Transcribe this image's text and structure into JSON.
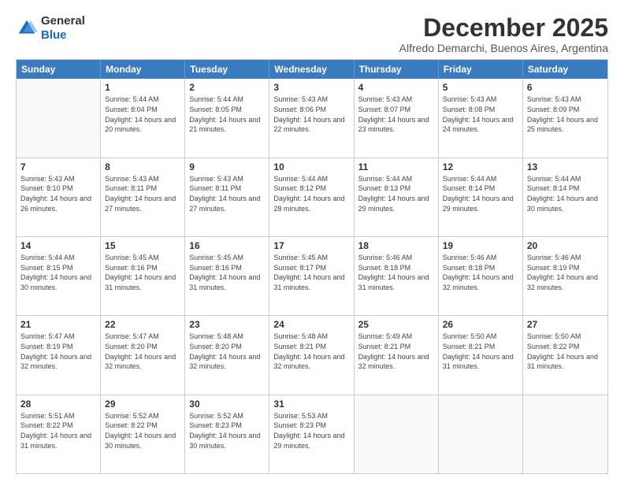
{
  "logo": {
    "general": "General",
    "blue": "Blue"
  },
  "title": "December 2025",
  "subtitle": "Alfredo Demarchi, Buenos Aires, Argentina",
  "days": [
    "Sunday",
    "Monday",
    "Tuesday",
    "Wednesday",
    "Thursday",
    "Friday",
    "Saturday"
  ],
  "weeks": [
    [
      {
        "day": "",
        "sunrise": "",
        "sunset": "",
        "daylight": ""
      },
      {
        "day": "1",
        "sunrise": "Sunrise: 5:44 AM",
        "sunset": "Sunset: 8:04 PM",
        "daylight": "Daylight: 14 hours and 20 minutes."
      },
      {
        "day": "2",
        "sunrise": "Sunrise: 5:44 AM",
        "sunset": "Sunset: 8:05 PM",
        "daylight": "Daylight: 14 hours and 21 minutes."
      },
      {
        "day": "3",
        "sunrise": "Sunrise: 5:43 AM",
        "sunset": "Sunset: 8:06 PM",
        "daylight": "Daylight: 14 hours and 22 minutes."
      },
      {
        "day": "4",
        "sunrise": "Sunrise: 5:43 AM",
        "sunset": "Sunset: 8:07 PM",
        "daylight": "Daylight: 14 hours and 23 minutes."
      },
      {
        "day": "5",
        "sunrise": "Sunrise: 5:43 AM",
        "sunset": "Sunset: 8:08 PM",
        "daylight": "Daylight: 14 hours and 24 minutes."
      },
      {
        "day": "6",
        "sunrise": "Sunrise: 5:43 AM",
        "sunset": "Sunset: 8:09 PM",
        "daylight": "Daylight: 14 hours and 25 minutes."
      }
    ],
    [
      {
        "day": "7",
        "sunrise": "Sunrise: 5:43 AM",
        "sunset": "Sunset: 8:10 PM",
        "daylight": "Daylight: 14 hours and 26 minutes."
      },
      {
        "day": "8",
        "sunrise": "Sunrise: 5:43 AM",
        "sunset": "Sunset: 8:11 PM",
        "daylight": "Daylight: 14 hours and 27 minutes."
      },
      {
        "day": "9",
        "sunrise": "Sunrise: 5:43 AM",
        "sunset": "Sunset: 8:11 PM",
        "daylight": "Daylight: 14 hours and 27 minutes."
      },
      {
        "day": "10",
        "sunrise": "Sunrise: 5:44 AM",
        "sunset": "Sunset: 8:12 PM",
        "daylight": "Daylight: 14 hours and 28 minutes."
      },
      {
        "day": "11",
        "sunrise": "Sunrise: 5:44 AM",
        "sunset": "Sunset: 8:13 PM",
        "daylight": "Daylight: 14 hours and 29 minutes."
      },
      {
        "day": "12",
        "sunrise": "Sunrise: 5:44 AM",
        "sunset": "Sunset: 8:14 PM",
        "daylight": "Daylight: 14 hours and 29 minutes."
      },
      {
        "day": "13",
        "sunrise": "Sunrise: 5:44 AM",
        "sunset": "Sunset: 8:14 PM",
        "daylight": "Daylight: 14 hours and 30 minutes."
      }
    ],
    [
      {
        "day": "14",
        "sunrise": "Sunrise: 5:44 AM",
        "sunset": "Sunset: 8:15 PM",
        "daylight": "Daylight: 14 hours and 30 minutes."
      },
      {
        "day": "15",
        "sunrise": "Sunrise: 5:45 AM",
        "sunset": "Sunset: 8:16 PM",
        "daylight": "Daylight: 14 hours and 31 minutes."
      },
      {
        "day": "16",
        "sunrise": "Sunrise: 5:45 AM",
        "sunset": "Sunset: 8:16 PM",
        "daylight": "Daylight: 14 hours and 31 minutes."
      },
      {
        "day": "17",
        "sunrise": "Sunrise: 5:45 AM",
        "sunset": "Sunset: 8:17 PM",
        "daylight": "Daylight: 14 hours and 31 minutes."
      },
      {
        "day": "18",
        "sunrise": "Sunrise: 5:46 AM",
        "sunset": "Sunset: 8:18 PM",
        "daylight": "Daylight: 14 hours and 31 minutes."
      },
      {
        "day": "19",
        "sunrise": "Sunrise: 5:46 AM",
        "sunset": "Sunset: 8:18 PM",
        "daylight": "Daylight: 14 hours and 32 minutes."
      },
      {
        "day": "20",
        "sunrise": "Sunrise: 5:46 AM",
        "sunset": "Sunset: 8:19 PM",
        "daylight": "Daylight: 14 hours and 32 minutes."
      }
    ],
    [
      {
        "day": "21",
        "sunrise": "Sunrise: 5:47 AM",
        "sunset": "Sunset: 8:19 PM",
        "daylight": "Daylight: 14 hours and 32 minutes."
      },
      {
        "day": "22",
        "sunrise": "Sunrise: 5:47 AM",
        "sunset": "Sunset: 8:20 PM",
        "daylight": "Daylight: 14 hours and 32 minutes."
      },
      {
        "day": "23",
        "sunrise": "Sunrise: 5:48 AM",
        "sunset": "Sunset: 8:20 PM",
        "daylight": "Daylight: 14 hours and 32 minutes."
      },
      {
        "day": "24",
        "sunrise": "Sunrise: 5:48 AM",
        "sunset": "Sunset: 8:21 PM",
        "daylight": "Daylight: 14 hours and 32 minutes."
      },
      {
        "day": "25",
        "sunrise": "Sunrise: 5:49 AM",
        "sunset": "Sunset: 8:21 PM",
        "daylight": "Daylight: 14 hours and 32 minutes."
      },
      {
        "day": "26",
        "sunrise": "Sunrise: 5:50 AM",
        "sunset": "Sunset: 8:21 PM",
        "daylight": "Daylight: 14 hours and 31 minutes."
      },
      {
        "day": "27",
        "sunrise": "Sunrise: 5:50 AM",
        "sunset": "Sunset: 8:22 PM",
        "daylight": "Daylight: 14 hours and 31 minutes."
      }
    ],
    [
      {
        "day": "28",
        "sunrise": "Sunrise: 5:51 AM",
        "sunset": "Sunset: 8:22 PM",
        "daylight": "Daylight: 14 hours and 31 minutes."
      },
      {
        "day": "29",
        "sunrise": "Sunrise: 5:52 AM",
        "sunset": "Sunset: 8:22 PM",
        "daylight": "Daylight: 14 hours and 30 minutes."
      },
      {
        "day": "30",
        "sunrise": "Sunrise: 5:52 AM",
        "sunset": "Sunset: 8:23 PM",
        "daylight": "Daylight: 14 hours and 30 minutes."
      },
      {
        "day": "31",
        "sunrise": "Sunrise: 5:53 AM",
        "sunset": "Sunset: 8:23 PM",
        "daylight": "Daylight: 14 hours and 29 minutes."
      },
      {
        "day": "",
        "sunrise": "",
        "sunset": "",
        "daylight": ""
      },
      {
        "day": "",
        "sunrise": "",
        "sunset": "",
        "daylight": ""
      },
      {
        "day": "",
        "sunrise": "",
        "sunset": "",
        "daylight": ""
      }
    ]
  ]
}
